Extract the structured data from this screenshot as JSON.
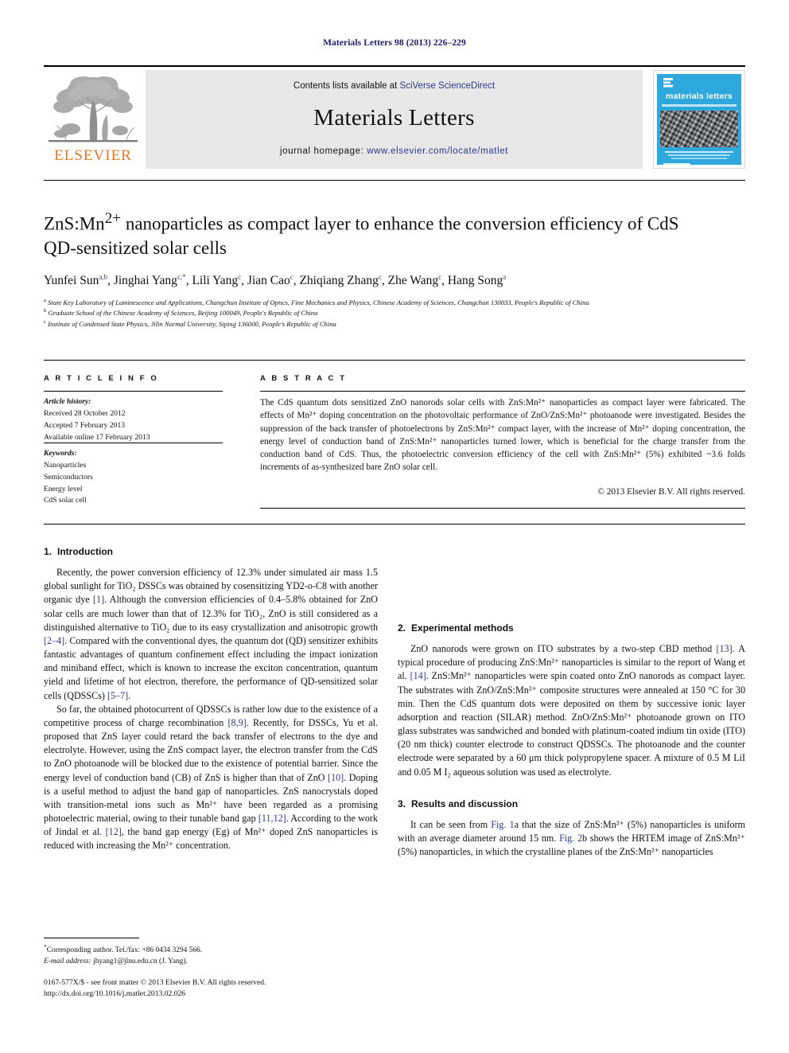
{
  "running_head": "Materials Letters 98 (2013) 226–229",
  "banner": {
    "publisher_wordmark": "ELSEVIER",
    "contents_prefix": "Contents lists available at ",
    "contents_link": "SciVerse ScienceDirect",
    "journal_name": "Materials Letters",
    "homepage_prefix": "journal homepage: ",
    "homepage_link": "www.elsevier.com/locate/matlet",
    "cover_title": "materials letters"
  },
  "article": {
    "title_line1_a": "ZnS:Mn",
    "title_sup": "2+",
    "title_line1_b": " nanoparticles as compact layer to enhance the conversion",
    "title_line2": "efficiency of CdS QD-sensitized solar cells",
    "authors": [
      {
        "name": "Yunfei Sun",
        "sup": "a,b"
      },
      {
        "name": "Jinghai Yang",
        "sup": "c,*"
      },
      {
        "name": "Lili Yang",
        "sup": "c"
      },
      {
        "name": "Jian Cao",
        "sup": "c"
      },
      {
        "name": "Zhiqiang Zhang",
        "sup": "c"
      },
      {
        "name": "Zhe Wang",
        "sup": "c"
      },
      {
        "name": "Hang Song",
        "sup": "a"
      }
    ],
    "affiliations": [
      {
        "mark": "a",
        "text": "State Key Laboratory of Luminescence and Applications, Changchun Institute of Optics, Fine Mechanics and Physics, Chinese Academy of Sciences, Changchun 130033, People's Republic of China"
      },
      {
        "mark": "b",
        "text": "Graduate School of the Chinese Academy of Sciences, Beijing 100049, People's Republic of China"
      },
      {
        "mark": "c",
        "text": "Institute of Condensed State Physics, Jilin Normal University, Siping 136000, People's Republic of China"
      }
    ]
  },
  "article_info": {
    "heading": "A R T I C L E   I N F O",
    "history_label": "Article history:",
    "history": [
      "Received 28 October 2012",
      "Accepted 7 February 2013",
      "Available online 17 February 2013"
    ],
    "keywords_label": "Keywords:",
    "keywords": [
      "Nanoparticles",
      "Semiconductors",
      "Energy level",
      "CdS solar cell"
    ]
  },
  "abstract": {
    "heading": "A B S T R A C T",
    "text": "The CdS quantum dots sensitized ZnO nanorods solar cells with ZnS:Mn²⁺ nanoparticles as compact layer were fabricated. The effects of Mn²⁺ doping concentration on the photovoltaic performance of ZnO/ZnS:Mn²⁺ photoanode were investigated. Besides the suppression of the back transfer of photoelectrons by ZnS:Mn²⁺ compact layer, with the increase of Mn²⁺ doping concentration, the energy level of conduction band of ZnS:Mn²⁺ nanoparticles turned lower, which is beneficial for the charge transfer from the conduction band of CdS. Thus, the photoelectric conversion efficiency of the cell with ZnS:Mn²⁺ (5%) exhibited ~3.6 folds increments of as-synthesized bare ZnO solar cell.",
    "copyright": "© 2013 Elsevier B.V. All rights reserved."
  },
  "sections": {
    "introduction": {
      "number": "1.",
      "title": "Introduction",
      "para1": "Recently, the power conversion efficiency of 12.3% under simulated air mass 1.5 global sunlight for TiO₂ DSSCs was obtained by cosensitizing YD2-o-C8 with another organic dye [1]. Although the conversion efficiencies of 0.4–5.8% obtained for ZnO solar cells are much lower than that of 12.3% for TiO₂, ZnO is still considered as a distinguished alternative to TiO₂ due to its easy crystallization and anisotropic growth [2–4]. Compared with the conventional dyes, the quantum dot (QD) sensitizer exhibits fantastic advantages of quantum confinement effect including the impact ionization and miniband effect, which is known to increase the exciton concentration, quantum yield and lifetime of hot electron, therefore, the performance of QD-sensitized solar cells (QDSSCs) [5–7].",
      "para2": "So far, the obtained photocurrent of QDSSCs is rather low due to the existence of a competitive process of charge recombination [8,9]. Recently, for DSSCs, Yu et al. proposed that ZnS layer could retard the back transfer of electrons to the dye and electrolyte. However, using the ZnS compact layer, the electron transfer from the CdS to ZnO photoanode will be blocked due to the existence of potential barrier. Since the energy level of conduction band (CB) of ZnS is higher than that of ZnO [10]. Doping is a useful method to adjust the band gap of nanoparticles. ZnS nanocrystals doped with transition-metal ions such as Mn²⁺ have been regarded as a promising photoelectric material, owing to their tunable band gap [11,12]. According to the work of Jindal et al. [12], the band gap energy (Eg) of Mn²⁺ doped ZnS nanoparticles is reduced with increasing the Mn²⁺ concentration."
    },
    "experimental": {
      "number": "2.",
      "title": "Experimental methods",
      "para1": "ZnO nanorods were grown on ITO substrates by a two-step CBD method [13]. A typical procedure of producing ZnS:Mn²⁺ nanoparticles is similar to the report of Wang et al. [14]. ZnS:Mn²⁺ nanoparticles were spin coated onto ZnO nanorods as compact layer. The substrates with ZnO/ZnS:Mn²⁺ composite structures were annealed at 150 °C for 30 min. Then the CdS quantum dots were deposited on them by successive ionic layer adsorption and reaction (SILAR) method. ZnO/ZnS:Mn²⁺ photoanode grown on ITO glass substrates was sandwiched and bonded with platinum-coated indium tin oxide (ITO) (20 nm thick) counter electrode to construct QDSSCs. The photoanode and the counter electrode were separated by a 60 μm thick polypropylene spacer. A mixture of 0.5 M LiI and 0.05 M I₂ aqueous solution was used as electrolyte."
    },
    "results": {
      "number": "3.",
      "title": "Results and discussion",
      "para1": "It can be seen from Fig. 1a that the size of ZnS:Mn²⁺ (5%) nanoparticles is uniform with an average diameter around 15 nm. Fig. 2b shows the HRTEM image of ZnS:Mn²⁺ (5%) nanoparticles, in which the crystalline planes of the ZnS:Mn²⁺ nanoparticles"
    }
  },
  "footnotes": {
    "corresponding": "Corresponding author. Tel./fax: +86 0434 3294 566.",
    "email_label": "E-mail address:",
    "email": "jhyang1@jlnu.edu.cn (J. Yang)."
  },
  "imprint": {
    "line1": "0167-577X/$ - see front matter © 2013 Elsevier B.V. All rights reserved.",
    "line2": "http://dx.doi.org/10.1016/j.matlet.2013.02.026"
  },
  "colors": {
    "link_blue": "#2b3a8f",
    "runhead_blue": "#1a1a6e",
    "elsevier_orange": "#E87722",
    "cover_cyan": "#2ea8dd",
    "banner_gray": "#e8e8e8"
  }
}
